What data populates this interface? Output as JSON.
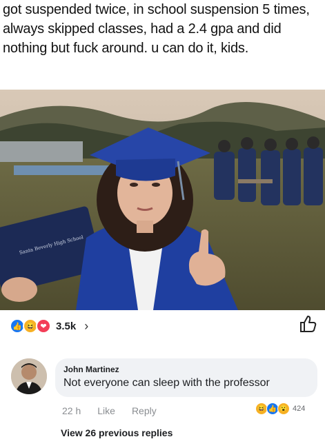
{
  "post": {
    "caption": "got suspended twice, in school suspension 5 times, always skipped classes, had a 2.4 gpa and did nothing but fuck around. u can do it, kids."
  },
  "reactions": {
    "count": "3.5k",
    "icons": [
      "like-icon",
      "haha-icon",
      "love-icon"
    ],
    "colors": {
      "like": "#1877f2",
      "haha": "#f7b125",
      "love": "#f33e58"
    }
  },
  "comment": {
    "author": "John Martinez",
    "text": "Not everyone can sleep with the professor",
    "time": "22 h",
    "like_label": "Like",
    "reply_label": "Reply",
    "reaction_count": "424",
    "reaction_icons": [
      "haha-icon",
      "like-icon",
      "wow-icon"
    ]
  },
  "view_replies": "View 26 previous replies"
}
